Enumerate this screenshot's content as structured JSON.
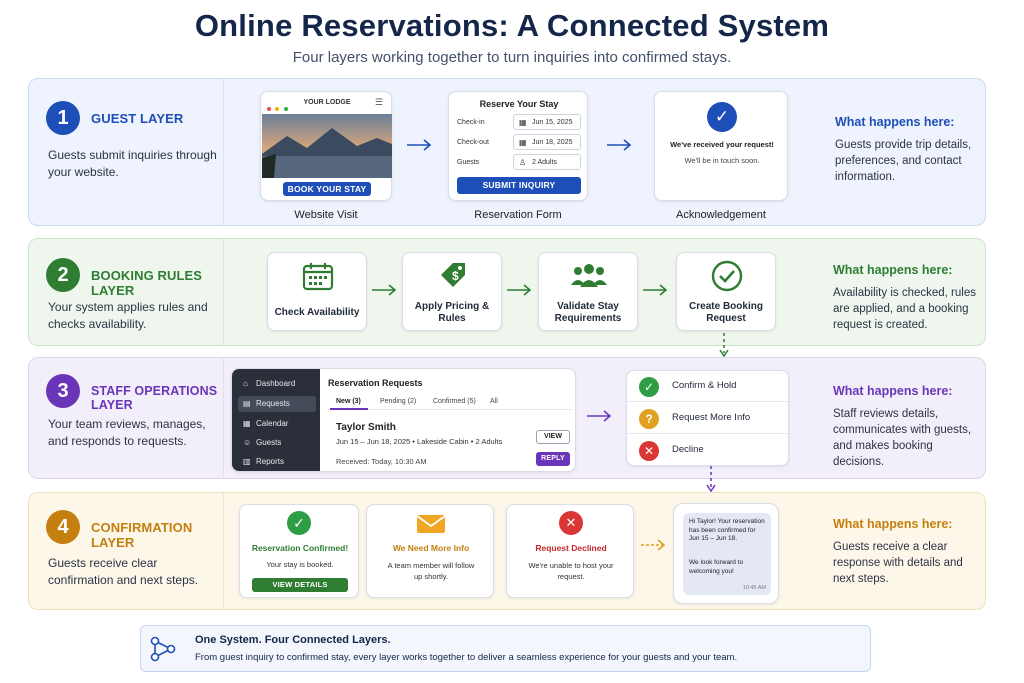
{
  "header": {
    "title": "Online Reservations: A Connected System",
    "subtitle": "Four layers working together to turn inquiries into confirmed stays."
  },
  "colors": {
    "blue": "#1e4fb8",
    "green": "#2e7d32",
    "purple": "#6a35b8",
    "amber": "#c47f0e",
    "navy": "#14264a"
  },
  "layers": [
    {
      "number": "1",
      "name": "GUEST LAYER",
      "description": "Guests submit inquiries through your website.",
      "what_heading": "What happens here:",
      "what_text": "Guests provide trip details, preferences, and contact information.",
      "website": {
        "logo": "YOUR LODGE",
        "button": "BOOK YOUR STAY",
        "caption": "Website Visit"
      },
      "form": {
        "title": "Reserve Your Stay",
        "checkin_label": "Check-in",
        "checkin_value": "Jun 15, 2025",
        "checkout_label": "Check-out",
        "checkout_value": "Jun 18, 2025",
        "guests_label": "Guests",
        "guests_value": "2 Adults",
        "button": "SUBMIT INQUIRY",
        "caption": "Reservation Form"
      },
      "ack": {
        "line1": "We've received your request!",
        "line2": "We'll be in touch soon.",
        "caption": "Acknowledgement"
      }
    },
    {
      "number": "2",
      "name": "BOOKING RULES LAYER",
      "description": "Your system applies rules and checks availability.",
      "what_heading": "What happens here:",
      "what_text": "Availability is checked, rules are applied, and a booking request is created.",
      "steps": [
        {
          "label": "Check Availability",
          "icon": "calendar-icon"
        },
        {
          "label": "Apply Pricing & Rules",
          "icon": "price-tag-icon"
        },
        {
          "label": "Validate Stay Requirements",
          "icon": "people-icon"
        },
        {
          "label": "Create Booking Request",
          "icon": "check-circle-icon"
        }
      ]
    },
    {
      "number": "3",
      "name": "STAFF OPERATIONS LAYER",
      "description": "Your team reviews, manages, and responds to requests.",
      "what_heading": "What happens here:",
      "what_text": "Staff reviews details, communicates with guests, and makes booking decisions.",
      "sidebar": [
        "Dashboard",
        "Requests",
        "Calendar",
        "Guests",
        "Reports"
      ],
      "panel": {
        "title": "Reservation Requests",
        "tabs": [
          "New (3)",
          "Pending (2)",
          "Confirmed (5)",
          "All"
        ],
        "guest": "Taylor Smith",
        "details": "Jun 15 – Jun 18, 2025  •  Lakeside Cabin  •  2 Adults",
        "received": "Received: Today, 10:30 AM",
        "view": "VIEW",
        "reply": "REPLY"
      },
      "options": [
        "Confirm & Hold",
        "Request More Info",
        "Decline"
      ]
    },
    {
      "number": "4",
      "name": "CONFIRMATION LAYER",
      "description": "Guests receive clear confirmation and next steps.",
      "what_heading": "What happens here:",
      "what_text": "Guests receive a clear response with details and next steps.",
      "confirmed": {
        "title": "Reservation Confirmed!",
        "text": "Your stay is booked.",
        "button": "VIEW DETAILS"
      },
      "more_info": {
        "title": "We Need More Info",
        "text": "A team member will follow up shortly."
      },
      "declined": {
        "title": "Request Declined",
        "text": "We're unable to host your request."
      },
      "message": {
        "text1": "Hi Taylor! Your reservation has been confirmed for Jun 15 – Jun 18.",
        "text2": "We look forward to welcoming you!",
        "time": "10:45 AM"
      }
    }
  ],
  "footer": {
    "title": "One System. Four Connected Layers.",
    "text": "From guest inquiry to confirmed stay, every layer works together to deliver a seamless experience for your guests and your team."
  }
}
